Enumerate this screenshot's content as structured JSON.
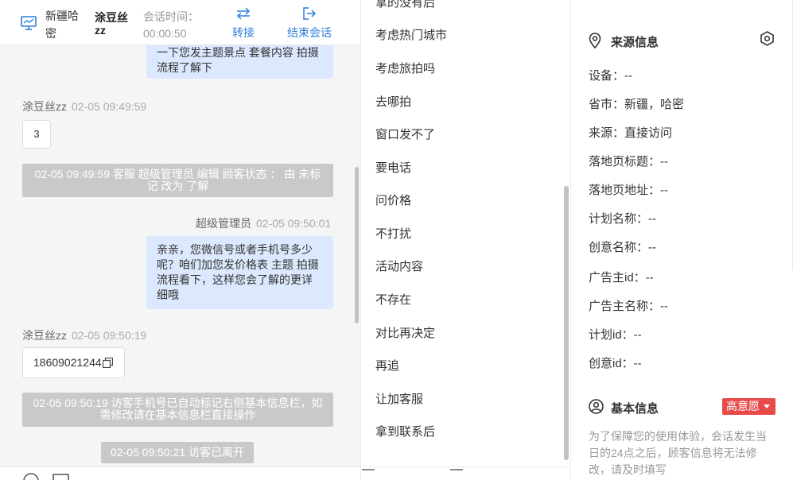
{
  "header": {
    "region": "新疆哈密",
    "customer_name": "涂豆丝zz",
    "session_time_label": "会话时间：",
    "session_time": "00:00:50",
    "transfer_label": "转接",
    "end_label": "结束会话"
  },
  "messages": {
    "m1_text": "一下您发主题景点 套餐内容 拍摄流程了解下",
    "m2_sender": "涂豆丝zz",
    "m2_time": "02-05 09:49:59",
    "m2_text": "3",
    "sys1": "02-05 09:49:59 客服 超级管理员 编辑 顾客状态 ： 由 未标记 改为 了解",
    "m3_sender": "超级管理员",
    "m3_time": "02-05 09:50:01",
    "m3_text": "亲亲，您微信号或者手机号多少呢？咱们加您发价格表 主题 拍摄流程看下，这样您会了解的更详细哦",
    "m4_sender": "涂豆丝zz",
    "m4_time": "02-05 09:50:19",
    "m4_text": "18609021244",
    "sys2": "02-05 09:50:19 访客手机号已自动标记右侧基本信息栏，如需修改请在基本信息栏直接操作",
    "sys3": "02-05 09:50:21 访客已离开"
  },
  "quick_replies": {
    "items": [
      "拿的没有后",
      "考虑热门城市",
      "考虑旅拍吗",
      "去哪拍",
      "窗口发不了",
      "要电话",
      "问价格",
      "不打扰",
      "活动内容",
      "不存在",
      "对比再决定",
      "再追",
      "让加客服",
      "拿到联系后"
    ]
  },
  "info": {
    "source_title": "来源信息",
    "device": "设备：--",
    "province": "省市：新疆，哈密",
    "source": "来源：直接访问",
    "landing_title": "落地页标题：--",
    "landing_url": "落地页地址：--",
    "plan_name": "计划名称：--",
    "creative_name": "创意名称：--",
    "advertiser_id": "广告主id：--",
    "advertiser_name": "广告主名称：--",
    "plan_id": "计划id：--",
    "creative_id": "创意id：--",
    "basic_title": "基本信息",
    "intent_badge": "高意愿",
    "notice": "为了保障您的使用体验，会话发生当日的24点之后，顾客信息将无法修改，请及时填写"
  },
  "colors": {
    "accent": "#2d7dda",
    "bubble_self": "#dce8fd",
    "system_bg": "#c9c9c9",
    "badge": "#e84a4a"
  }
}
